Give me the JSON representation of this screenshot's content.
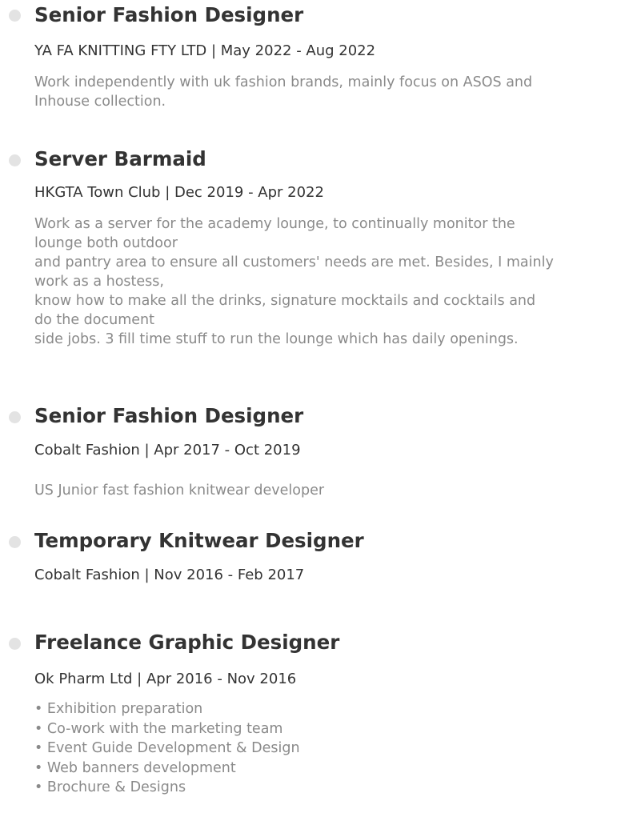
{
  "entries": [
    {
      "title": "Senior Fashion Designer",
      "meta": "YA FA KNITTING FTY LTD | May 2022 - Aug 2022",
      "description": [
        "Work independently with uk fashion brands, mainly focus on ASOS and",
        "Inhouse collection."
      ]
    },
    {
      "title": "Server Barmaid",
      "meta": "HKGTA Town Club | Dec 2019 - Apr 2022",
      "description": [
        "Work as a server for the academy lounge, to continually monitor the",
        "lounge both outdoor",
        "and pantry area to ensure all customers' needs are met. Besides, I mainly",
        "work as a hostess,",
        "know how to make all the drinks, signature mocktails and cocktails and",
        "do the document",
        "side jobs. 3 fill time stuff to run the lounge which has daily openings."
      ]
    },
    {
      "title": "Senior Fashion Designer",
      "meta": "Cobalt Fashion | Apr 2017 - Oct 2019",
      "description": [
        "US Junior fast fashion knitwear developer"
      ]
    },
    {
      "title": "Temporary Knitwear Designer",
      "meta": "Cobalt Fashion | Nov 2016 - Feb 2017",
      "description": []
    },
    {
      "title": "Freelance Graphic Designer",
      "meta": "Ok Pharm Ltd | Apr 2016 - Nov 2016",
      "bullets": [
        "Exhibition preparation",
        "Co-work with the marketing team",
        "Event Guide Development & Design",
        "Web banners development",
        "Brochure & Designs"
      ]
    }
  ]
}
